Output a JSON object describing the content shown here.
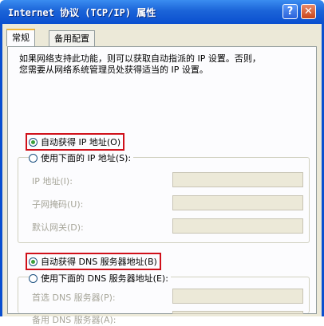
{
  "window": {
    "title": "Internet 协议 (TCP/IP) 属性",
    "help_label": "?",
    "close_label": "✕"
  },
  "tabs": [
    {
      "label": "常规",
      "selected": true
    },
    {
      "label": "备用配置",
      "selected": false
    }
  ],
  "description": {
    "line1": "如果网络支持此功能，则可以获取自动指派的 IP 设置。否则，",
    "line2": "您需要从网络系统管理员处获得适当的 IP 设置。"
  },
  "ip_section": {
    "auto_label": "自动获得 IP 地址(O)",
    "auto_selected": true,
    "manual_label": "使用下面的 IP 地址(S):",
    "fields": [
      {
        "label": "IP 地址(I):",
        "value": ""
      },
      {
        "label": "子网掩码(U):",
        "value": ""
      },
      {
        "label": "默认网关(D):",
        "value": ""
      }
    ]
  },
  "dns_section": {
    "auto_label": "自动获得 DNS 服务器地址(B)",
    "auto_selected": true,
    "manual_label": "使用下面的 DNS 服务器地址(E):",
    "fields": [
      {
        "label": "首选 DNS 服务器(P):",
        "value": ""
      },
      {
        "label": "备用 DNS 服务器(A):",
        "value": ""
      }
    ]
  },
  "colors": {
    "titlebar": "#0a4fcf",
    "highlight_border": "#d0101a",
    "dialog_bg": "#ece9d8"
  }
}
